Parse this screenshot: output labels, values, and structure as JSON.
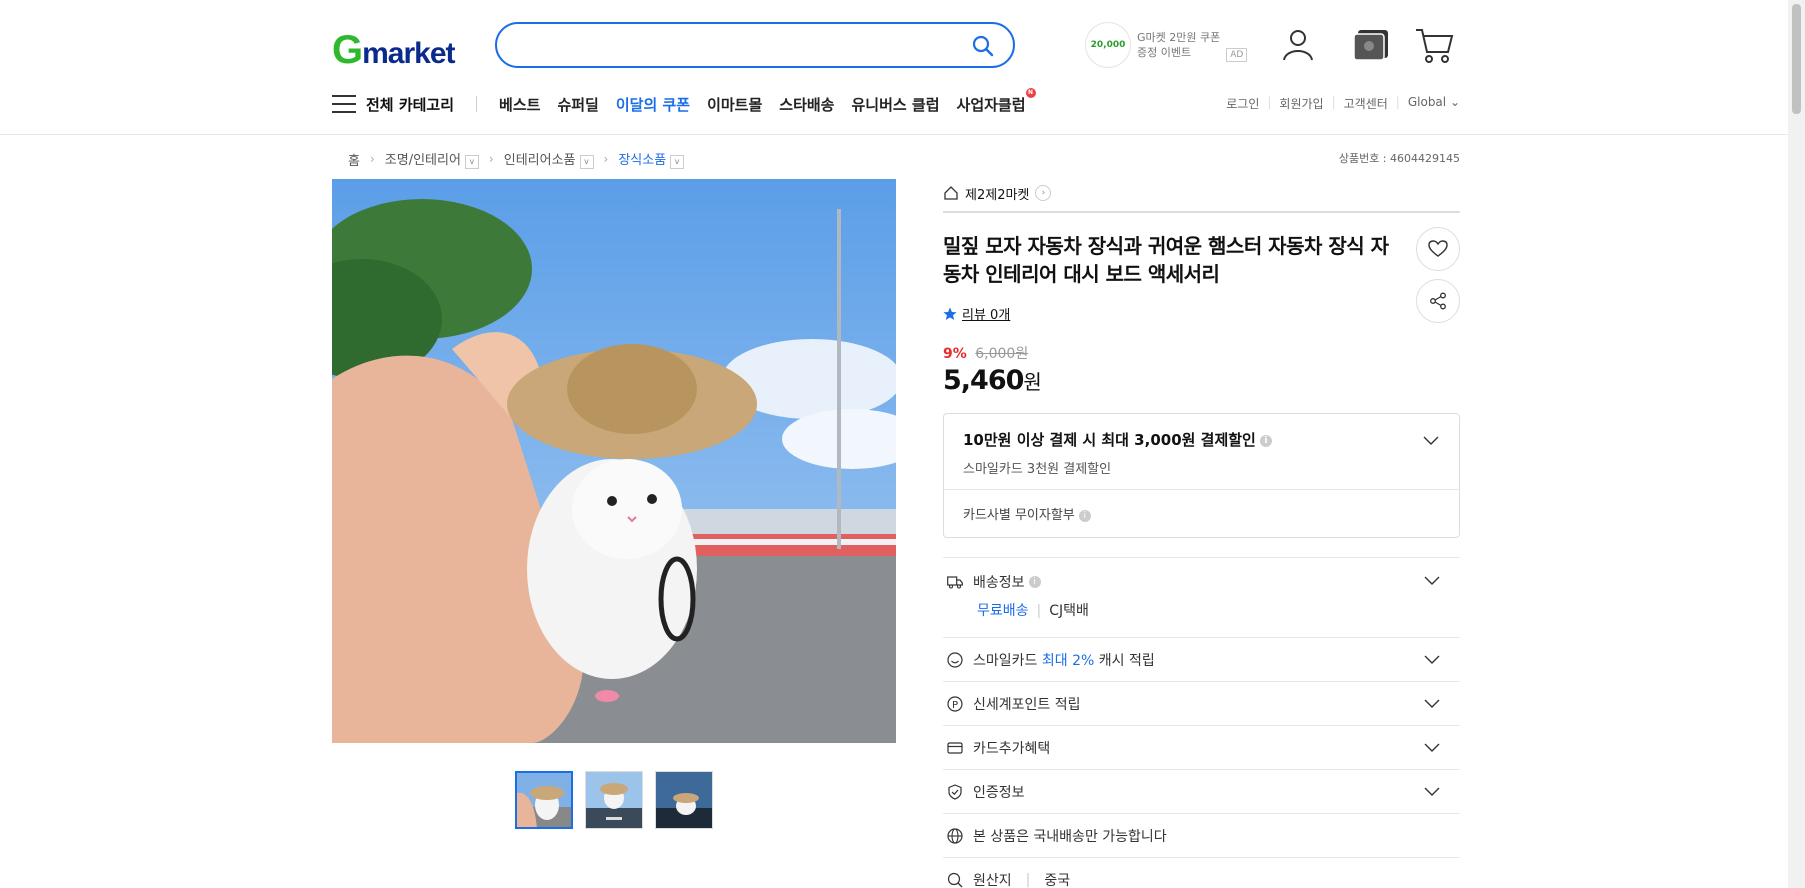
{
  "header": {
    "logo_g": "G",
    "logo_rest": "market",
    "search_placeholder": "",
    "ad_amount": "20,000",
    "ad_line1": "G마켓 2만원 쿠폰",
    "ad_line2": "증정 이벤트",
    "ad_tag": "AD"
  },
  "nav": {
    "all_categories": "전체 카테고리",
    "items": [
      "베스트",
      "슈퍼딜",
      "이달의 쿠폰",
      "이마트몰",
      "스타배송",
      "유니버스 클럽",
      "사업자클럽"
    ],
    "util": [
      "로그인",
      "회원가입",
      "고객센터",
      "Global"
    ]
  },
  "breadcrumb": {
    "home": "홈",
    "c1": "조명/인테리어",
    "c2": "인테리어소품",
    "c3": "장식소품",
    "product_no": "상품번호 : 4604429145"
  },
  "product": {
    "shop": "제2제2마켓",
    "title": "밀짚 모자 자동차 장식과 귀여운 햄스터 자동차 장식 자동차 인테리어 대시 보드 액세서리",
    "review": "리뷰 0개",
    "discount": "9%",
    "original_price": "6,000원",
    "price": "5,460",
    "price_unit": "원"
  },
  "card": {
    "headline": "10만원 이상 결제 시 최대 3,000원 결제할인",
    "sub": "스마일카드 3천원 결제할인",
    "installment": "카드사별 무이자할부"
  },
  "rows": {
    "ship_label": "배송정보",
    "ship_free": "무료배송",
    "ship_courier": "CJ택배",
    "smile_pre": "스마일카드",
    "smile_hl": "최대 2%",
    "smile_post": "캐시 적립",
    "point": "신세계포인트 적립",
    "card_benefit": "카드추가혜택",
    "cert": "인증정보",
    "domestic": "본 상품은 국내배송만 가능합니다",
    "origin_label": "원산지",
    "origin_value": "중국"
  }
}
